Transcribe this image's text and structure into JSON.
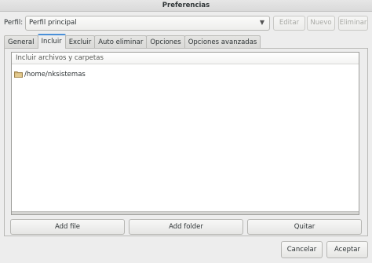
{
  "window": {
    "title": "Preferencias"
  },
  "profile": {
    "label": "Perfil:",
    "selected": "Perfil principal",
    "buttons": {
      "edit": "Editar",
      "new": "Nuevo",
      "delete": "Eliminar"
    }
  },
  "tabs": [
    {
      "label": "General",
      "active": false
    },
    {
      "label": "Incluir",
      "active": true
    },
    {
      "label": "Excluir",
      "active": false
    },
    {
      "label": "Auto eliminar",
      "active": false
    },
    {
      "label": "Opciones",
      "active": false
    },
    {
      "label": "Opciones avanzadas",
      "active": false
    }
  ],
  "include": {
    "header": "Incluir archivos y carpetas",
    "items": [
      {
        "path": "/home/nksistemas",
        "icon": "folder-icon"
      }
    ],
    "buttons": {
      "add_file": "Add file",
      "add_folder": "Add folder",
      "remove": "Quitar"
    }
  },
  "dialog": {
    "cancel": "Cancelar",
    "accept": "Aceptar"
  },
  "colors": {
    "active_tab_accent": "#4a90d9",
    "folder": "#c8a86a"
  }
}
